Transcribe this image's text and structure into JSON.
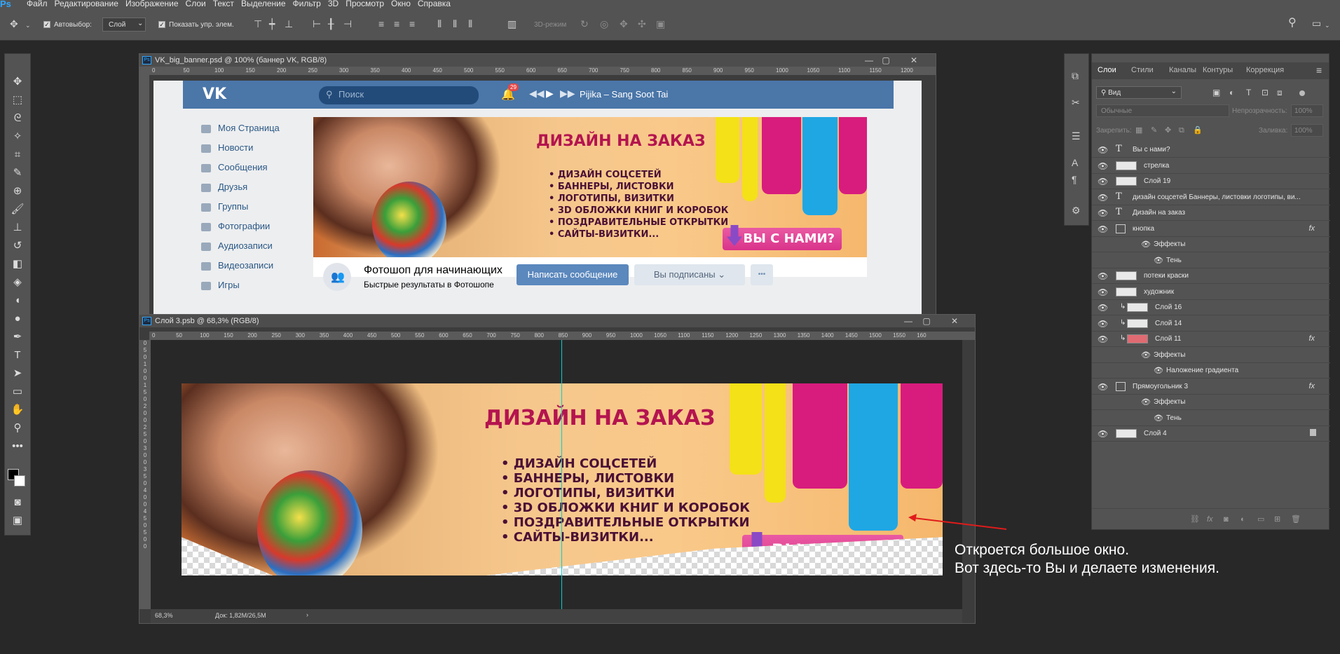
{
  "app": {
    "logo": "Ps"
  },
  "menu": [
    "Файл",
    "Редактирование",
    "Изображение",
    "Слои",
    "Текст",
    "Выделение",
    "Фильтр",
    "3D",
    "Просмотр",
    "Окно",
    "Справка"
  ],
  "options": {
    "autoselect_label": "Автовыбор:",
    "autoselect_value": "Слой",
    "show_controls_label": "Показать упр. элем.",
    "mode_3d": "3D-режим"
  },
  "doc1": {
    "title": "VK_big_banner.psd @ 100% (баннер VK, RGB/8)",
    "ruler_ticks": [
      "0",
      "50",
      "100",
      "150",
      "200",
      "250",
      "300",
      "350",
      "400",
      "450",
      "500",
      "550",
      "600",
      "650",
      "700",
      "750",
      "800",
      "850",
      "900",
      "950",
      "1000",
      "1050",
      "1100",
      "1150",
      "1200"
    ],
    "vk": {
      "search_placeholder": "Поиск",
      "notif_count": "29",
      "track": "Pijika – Sang Soot Tai",
      "nav": [
        "Моя Страница",
        "Новости",
        "Сообщения",
        "Друзья",
        "Группы",
        "Фотографии",
        "Аудиозаписи",
        "Видеозаписи",
        "Игры"
      ],
      "group_name": "Фотошоп для начинающих",
      "group_status": "Быстрые результаты в Фотошопе",
      "btn_message": "Написать сообщение",
      "btn_subscribed": "Вы подписаны",
      "btn_more": "•••"
    }
  },
  "banner": {
    "title": "ДИЗАЙН НА ЗАКАЗ",
    "items": [
      "ДИЗАЙН СОЦСЕТЕЙ",
      "БАННЕРЫ, ЛИСТОВКИ",
      "ЛОГОТИПЫ, ВИЗИТКИ",
      "3D ОБЛОЖКИ КНИГ И КОРОБОК",
      "ПОЗДРАВИТЕЛЬНЫЕ ОТКРЫТКИ",
      "САЙТЫ-ВИЗИТКИ..."
    ],
    "cta": "ВЫ С НАМИ?"
  },
  "doc2": {
    "title": "Слой 3.psb @ 68,3% (RGB/8)",
    "ruler_ticks": [
      "0",
      "50",
      "100",
      "150",
      "200",
      "250",
      "300",
      "350",
      "400",
      "450",
      "500",
      "550",
      "600",
      "650",
      "700",
      "750",
      "800",
      "850",
      "900",
      "950",
      "1000",
      "1050",
      "1100",
      "1150",
      "1200",
      "1250",
      "1300",
      "1350",
      "1400",
      "1450",
      "1500",
      "1550",
      "160"
    ],
    "vruler": [
      "0",
      "5",
      "0",
      "1",
      "0",
      "0",
      "1",
      "5",
      "0",
      "2",
      "0",
      "0",
      "2",
      "5",
      "0",
      "3",
      "0",
      "0",
      "3",
      "5",
      "0",
      "4",
      "0",
      "0",
      "4",
      "5",
      "0",
      "5",
      "0",
      "0"
    ],
    "zoom": "68,3%",
    "doc_info": "Док: 1,82М/26,5М"
  },
  "layers_panel": {
    "tabs": [
      "Слои",
      "Стили",
      "Каналы",
      "Контуры",
      "Коррекция"
    ],
    "filter": "Вид",
    "blend": "Обычные",
    "opacity_label": "Непрозрачность:",
    "opacity": "100%",
    "lock_label": "Закрепить:",
    "fill_label": "Заливка:",
    "fill": "100%",
    "layers": [
      {
        "name": "Вы с нами?",
        "kind": "text",
        "indent": 0
      },
      {
        "name": "стрелка",
        "kind": "pixel",
        "indent": 0
      },
      {
        "name": "Слой 19",
        "kind": "pixel",
        "indent": 0
      },
      {
        "name": "дизайн соцсетей Баннеры, листовки логотипы, ви...",
        "kind": "text",
        "indent": 0
      },
      {
        "name": "Дизайн на заказ",
        "kind": "text",
        "indent": 0
      },
      {
        "name": "кнопка",
        "kind": "smart",
        "indent": 0,
        "fx": "fx"
      },
      {
        "name": "Эффекты",
        "kind": "effect",
        "indent": 1
      },
      {
        "name": "Тень",
        "kind": "effect",
        "indent": 2
      },
      {
        "name": "потеки краски",
        "kind": "pixel",
        "indent": 0
      },
      {
        "name": "художник",
        "kind": "pixel",
        "indent": 0
      },
      {
        "name": "Слой 16",
        "kind": "clip",
        "indent": 0
      },
      {
        "name": "Слой 14",
        "kind": "clip",
        "indent": 0
      },
      {
        "name": "Слой 11",
        "kind": "clippink",
        "indent": 0,
        "fx": "fx"
      },
      {
        "name": "Эффекты",
        "kind": "effect",
        "indent": 1
      },
      {
        "name": "Наложение градиента",
        "kind": "effect",
        "indent": 2
      },
      {
        "name": "Прямоугольник 3",
        "kind": "smart",
        "indent": 0,
        "fx": "fx"
      },
      {
        "name": "Эффекты",
        "kind": "effect",
        "indent": 1
      },
      {
        "name": "Тень",
        "kind": "effect",
        "indent": 2
      },
      {
        "name": "Слой 4",
        "kind": "pixel",
        "indent": 0,
        "locked": true
      }
    ]
  },
  "annotation": {
    "line1": "Откроется большое окно.",
    "line2": "Вот здесь-то Вы и делаете изменения."
  },
  "colors": {
    "ps_bg": "#282828",
    "ps_panel": "#535353",
    "vk_blue": "#4a76a8",
    "banner_title": "#b4144f",
    "cta_pink": "#e44c9a",
    "guide": "#00d4d4",
    "arrow": "#e01b1b"
  }
}
